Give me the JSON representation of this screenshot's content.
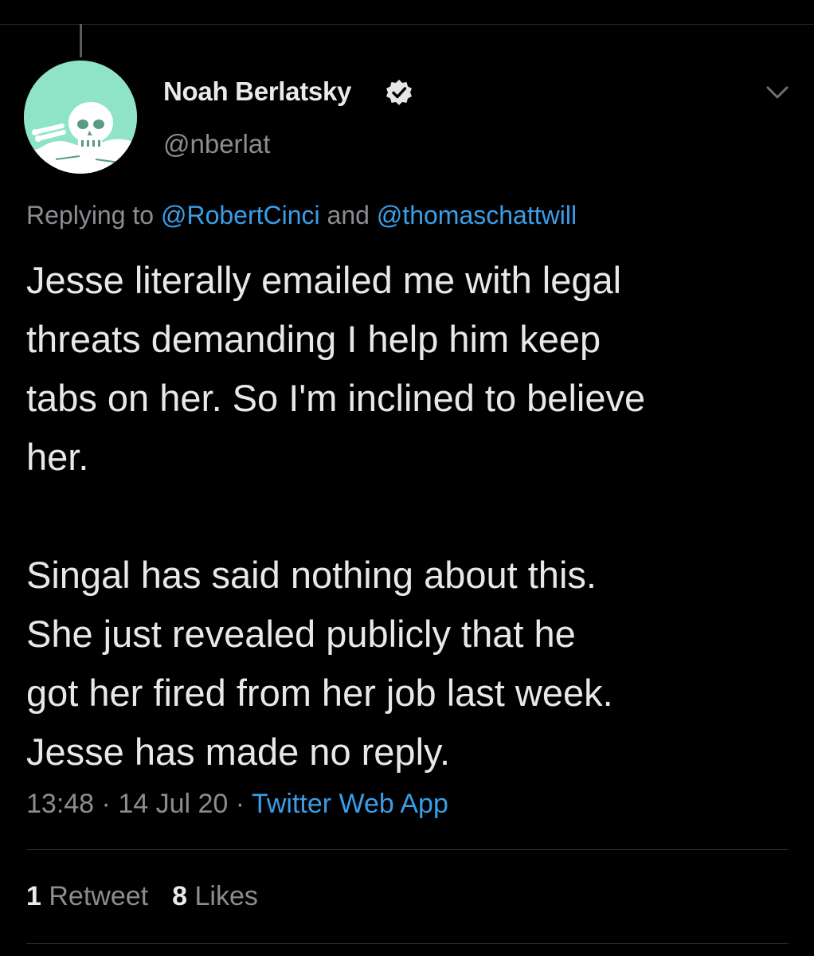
{
  "tweet": {
    "author_name": "Noah Berlatsky",
    "author_handle": "@nberlat",
    "avatar_icon": "skull-icon",
    "verified_icon": "verified-badge-icon",
    "menu_icon": "chevron-down-icon",
    "replying": {
      "prefix": "Replying to ",
      "mention_1": "@RobertCinci",
      "conjunction": " and ",
      "mention_2": "@thomaschattwill"
    },
    "body_lines": [
      "Jesse literally emailed me with legal",
      "threats demanding I help him keep",
      "tabs on her. So I'm inclined to believe",
      "her.",
      "",
      "Singal has said nothing about this.",
      "She just revealed publicly that he",
      "got her fired from her job last week.",
      "Jesse has made no reply."
    ],
    "time": "13:48",
    "separator_1": " · ",
    "date": "14 Jul 20",
    "separator_2": " · ",
    "source": "Twitter Web App",
    "retweet_count": "1",
    "retweet_label": "Retweet",
    "like_count": "8",
    "like_label": "Likes"
  },
  "colors": {
    "background": "#000000",
    "text": "#e8e8e8",
    "muted": "#8a8d91",
    "link": "#3a9ee8",
    "avatar_bg": "#8fe3c7"
  }
}
